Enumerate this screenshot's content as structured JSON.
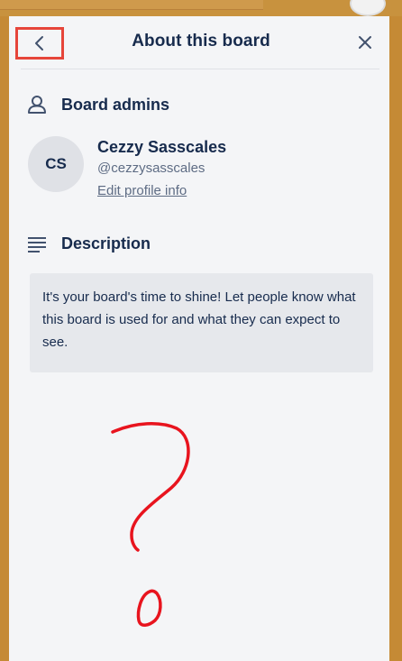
{
  "panel": {
    "title": "About this board",
    "back_icon": "chevron-left-icon",
    "close_icon": "close-icon"
  },
  "admins": {
    "heading": "Board admins",
    "heading_icon": "person-icon",
    "admin": {
      "initials": "CS",
      "name": "Cezzy Sasscales",
      "username": "@cezzysasscales",
      "edit_link": "Edit profile info"
    }
  },
  "description": {
    "heading": "Description",
    "heading_icon": "text-lines-icon",
    "placeholder": "It's your board's time to shine! Let people know what this board is used for and what they can expect to see."
  },
  "colors": {
    "highlight_box": "#e6453a",
    "annotation": "#e8141e",
    "background": "#c58a35",
    "panel": "#f4f5f7"
  }
}
